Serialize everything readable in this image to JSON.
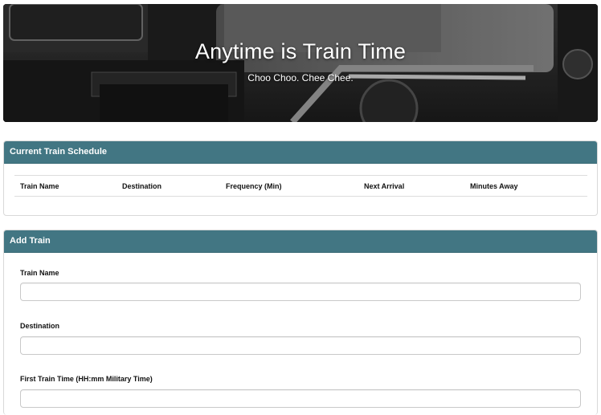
{
  "header": {
    "title": "Anytime is Train Time",
    "subtitle": "Choo Choo. Chee Chee."
  },
  "schedule": {
    "panel_title": "Current Train Schedule",
    "columns": [
      "Train Name",
      "Destination",
      "Frequency (Min)",
      "Next Arrival",
      "Minutes Away"
    ]
  },
  "add_train": {
    "panel_title": "Add Train",
    "fields": [
      {
        "label": "Train Name",
        "value": ""
      },
      {
        "label": "Destination",
        "value": ""
      },
      {
        "label": "First Train Time (HH:mm Military Time)",
        "value": ""
      }
    ]
  },
  "colors": {
    "panel_header": "#427683"
  }
}
